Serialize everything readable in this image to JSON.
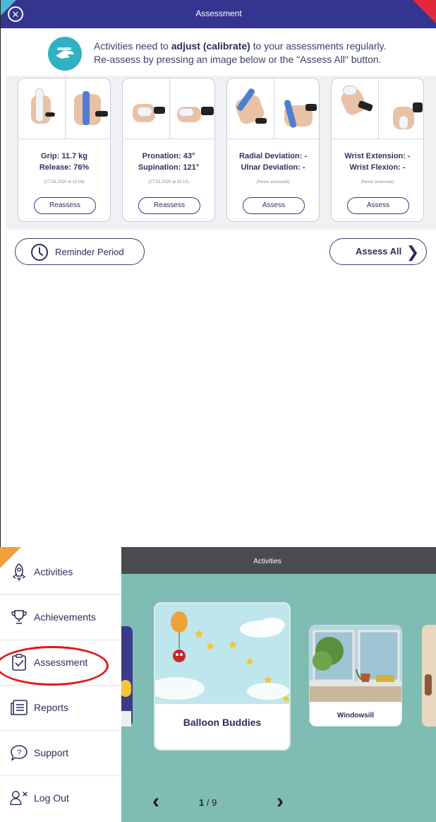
{
  "assessment_screen": {
    "title": "Assessment",
    "info_line1_pre": "Activities need to ",
    "info_line1_bold": "adjust (calibrate)",
    "info_line1_post": " to your assessments regularly.",
    "info_line2": "Re-assess by pressing an image below or the \"Assess All\" button.",
    "cards": [
      {
        "line1": "Grip: 11.7 kg",
        "line2": "Release: 76%",
        "date": "(27.03.2020 at 10:06)",
        "button": "Reassess"
      },
      {
        "line1": "Pronation: 43°",
        "line2": "Supination: 121°",
        "date": "(27.03.2020 at 10:15)",
        "button": "Reassess"
      },
      {
        "line1": "Radial Deviation: -",
        "line2": "Ulnar Deviation: -",
        "date": "(Never assessed)",
        "button": "Assess"
      },
      {
        "line1": "Wrist Extension: -",
        "line2": "Wrist Flexion: -",
        "date": "(Never assessed)",
        "button": "Assess"
      }
    ],
    "reminder_label": "Reminder Period",
    "assess_all_label": "Assess All"
  },
  "menu": {
    "items": [
      {
        "label": "Activities",
        "icon": "rocket-icon"
      },
      {
        "label": "Achievements",
        "icon": "trophy-icon"
      },
      {
        "label": "Assessment",
        "icon": "clipboard-check-icon"
      },
      {
        "label": "Reports",
        "icon": "report-list-icon"
      },
      {
        "label": "Support",
        "icon": "question-icon"
      },
      {
        "label": "Log Out",
        "icon": "user-logout-icon"
      }
    ]
  },
  "activities_screen": {
    "title": "Activities",
    "tiles": [
      {
        "name": "Balloon Buddies"
      },
      {
        "name": "Windowsill"
      }
    ],
    "pager": {
      "current": "1",
      "total": "/ 9"
    }
  },
  "colors": {
    "titlebar": "#33358e",
    "accent_teal": "#2fb1c4",
    "activities_bg": "#7fbcb3",
    "highlight": "#e01818"
  }
}
